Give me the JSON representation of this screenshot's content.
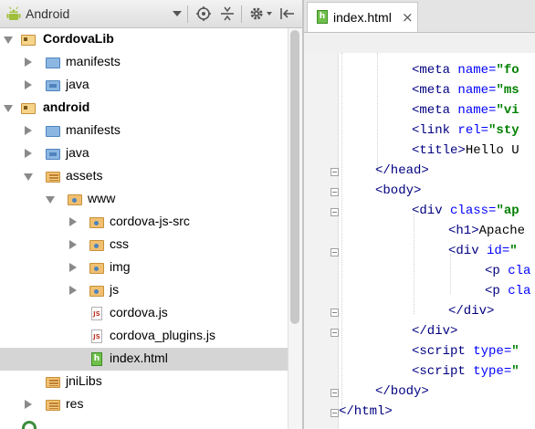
{
  "toolbar": {
    "view_name": "Android"
  },
  "tree": {
    "items": [
      {
        "label": "CordovaLib",
        "expanded": true,
        "bold": true,
        "icon": "module-folder-icon"
      },
      {
        "label": "manifests",
        "expanded": false,
        "icon": "folder-icon"
      },
      {
        "label": "java",
        "expanded": false,
        "icon": "source-folder-icon"
      },
      {
        "label": "android",
        "expanded": true,
        "bold": true,
        "icon": "module-folder-icon"
      },
      {
        "label": "manifests",
        "expanded": false,
        "icon": "folder-icon"
      },
      {
        "label": "java",
        "expanded": false,
        "icon": "source-folder-icon"
      },
      {
        "label": "assets",
        "expanded": true,
        "icon": "resource-folder-icon"
      },
      {
        "label": "www",
        "expanded": true,
        "icon": "package-folder-icon"
      },
      {
        "label": "cordova-js-src",
        "expanded": false,
        "icon": "package-folder-icon"
      },
      {
        "label": "css",
        "expanded": false,
        "icon": "package-folder-icon"
      },
      {
        "label": "img",
        "expanded": false,
        "icon": "package-folder-icon"
      },
      {
        "label": "js",
        "expanded": false,
        "icon": "package-folder-icon"
      },
      {
        "label": "cordova.js",
        "icon": "js-file-icon"
      },
      {
        "label": "cordova_plugins.js",
        "icon": "js-file-icon"
      },
      {
        "label": "index.html",
        "icon": "html-file-icon",
        "selected": true
      },
      {
        "label": "jniLibs",
        "icon": "resource-folder-icon"
      },
      {
        "label": "res",
        "expanded": false,
        "icon": "resource-folder-icon"
      }
    ]
  },
  "editor": {
    "tab_label": "index.html",
    "tab_close": "×",
    "lines": [
      {
        "tag": "<meta ",
        "attr": "name=",
        "val": "\"fo"
      },
      {
        "tag": "<meta ",
        "attr": "name=",
        "val": "\"ms"
      },
      {
        "tag": "<meta ",
        "attr": "name=",
        "val": "\"vi"
      },
      {
        "tag": "<link ",
        "attr": "rel=",
        "val": "\"sty"
      },
      {
        "tag": "<title>",
        "txt": "Hello U"
      },
      {
        "tag": "</head>"
      },
      {
        "tag": "<body>"
      },
      {
        "tag": "<div ",
        "attr": "class=",
        "val": "\"ap"
      },
      {
        "tag": "<h1>",
        "txt": "Apache"
      },
      {
        "tag": "<div ",
        "attr": "id=",
        "val": "\""
      },
      {
        "tag": "<p ",
        "attr": "cla"
      },
      {
        "tag": "<p ",
        "attr": "cla"
      },
      {
        "tag": "</div>"
      },
      {
        "tag": "</div>"
      },
      {
        "tag": "<script ",
        "attr": "type=",
        "val": "\""
      },
      {
        "tag": "<script ",
        "attr": "type=",
        "val": "\""
      },
      {
        "tag": "</body>"
      },
      {
        "tag": "</html>"
      }
    ]
  }
}
